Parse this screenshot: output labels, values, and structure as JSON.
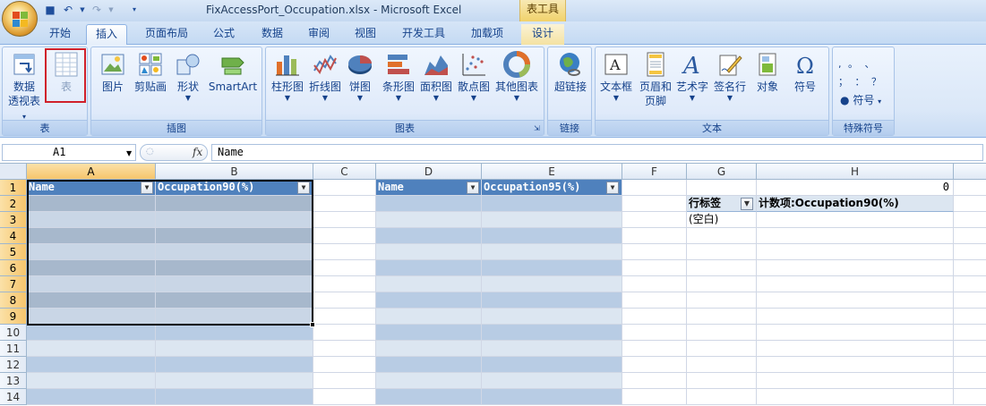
{
  "titlebar": {
    "document_title": "FixAccessPort_Occupation.xlsx - Microsoft Excel",
    "context_tab_group": "表工具"
  },
  "tabs": [
    {
      "label": "开始"
    },
    {
      "label": "插入",
      "active": true
    },
    {
      "label": "页面布局"
    },
    {
      "label": "公式"
    },
    {
      "label": "数据"
    },
    {
      "label": "审阅"
    },
    {
      "label": "视图"
    },
    {
      "label": "开发工具"
    },
    {
      "label": "加载项"
    },
    {
      "label": "设计",
      "contextual": true
    }
  ],
  "ribbon": {
    "groups": {
      "table": {
        "label": "表",
        "buttons": {
          "pivot": {
            "line1": "数据",
            "line2": "透视表"
          },
          "table": {
            "label": "表"
          }
        }
      },
      "illustrations": {
        "label": "插图",
        "buttons": {
          "picture": "图片",
          "clipart": "剪贴画",
          "shapes": "形状",
          "smartart": "SmartArt"
        }
      },
      "charts": {
        "label": "图表",
        "buttons": {
          "column": "柱形图",
          "line": "折线图",
          "pie": "饼图",
          "bar": "条形图",
          "area": "面积图",
          "scatter": "散点图",
          "other": "其他图表"
        }
      },
      "links": {
        "label": "链接",
        "buttons": {
          "hyperlink": "超链接"
        }
      },
      "text": {
        "label": "文本",
        "buttons": {
          "textbox": "文本框",
          "header_footer_1": "页眉和",
          "header_footer_2": "页脚",
          "wordart": "艺术字",
          "signature": "签名行",
          "object": "对象",
          "symbol": "符号"
        }
      },
      "special_symbols": {
        "label": "特殊符号",
        "symbols_row1": ", 。 、",
        "symbols_row2": "； ： ？",
        "button": "符号"
      }
    }
  },
  "formula_bar": {
    "name_box": "A1",
    "fx": "fx",
    "formula": "Name"
  },
  "sheet": {
    "columns": [
      "A",
      "B",
      "C",
      "D",
      "E",
      "F",
      "G",
      "H"
    ],
    "rows": [
      "1",
      "2",
      "3",
      "4",
      "5",
      "6",
      "7",
      "8",
      "9",
      "10",
      "11",
      "12",
      "13",
      "14"
    ],
    "selected_column": "A",
    "selected_rows": [
      "1",
      "2",
      "3",
      "4",
      "5",
      "6",
      "7",
      "8",
      "9"
    ],
    "table1": {
      "headers": [
        "Name",
        "Occupation90(%)"
      ]
    },
    "table2": {
      "headers": [
        "Name",
        "Occupation95(%)"
      ]
    },
    "h1_value": "0",
    "pivot": {
      "row_label": "行标签",
      "value_label": "计数项:Occupation90(%)",
      "blank": "(空白)"
    }
  }
}
